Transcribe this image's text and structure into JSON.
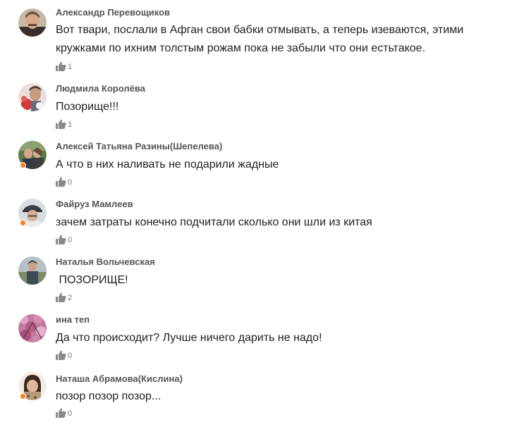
{
  "comments": [
    {
      "author": "Александр Перевощиков",
      "text": "Вот твари, послали в Афган свои бабки отмывать, а теперь изеваются, этими кружками по ихним толстым рожам пока не забыли что они естьтакое.",
      "likes": "1",
      "online": false
    },
    {
      "author": "Людмила Королёва",
      "text": "Позорище!!!",
      "likes": "1",
      "online": false
    },
    {
      "author": "Алексей Татьяна Разины(Шепелева)",
      "text": "А что в них наливать не подарили жадные",
      "likes": "0",
      "online": true
    },
    {
      "author": "Файруз Мамлеев",
      "text": "зачем затраты конечно подчитали сколько они шли из китая",
      "likes": "0",
      "online": true
    },
    {
      "author": "Наталья Вольчевская",
      "text": " ПОЗОРИЩЕ!",
      "likes": "2",
      "online": false
    },
    {
      "author": "ина теп",
      "text": "Да что происходит? Лучше ничего дарить не надо!",
      "likes": "0",
      "online": false
    },
    {
      "author": "Наташа Абрамова(Кислина)",
      "text": "позор позор позор...",
      "likes": "0",
      "online": true
    }
  ],
  "colors": {
    "author": "#555555",
    "text": "#222222",
    "like_icon": "#8a8a8a",
    "online_dot": "#f5821f"
  },
  "icons": {
    "like": "thumbs-up-icon",
    "online": "online-status-icon"
  }
}
